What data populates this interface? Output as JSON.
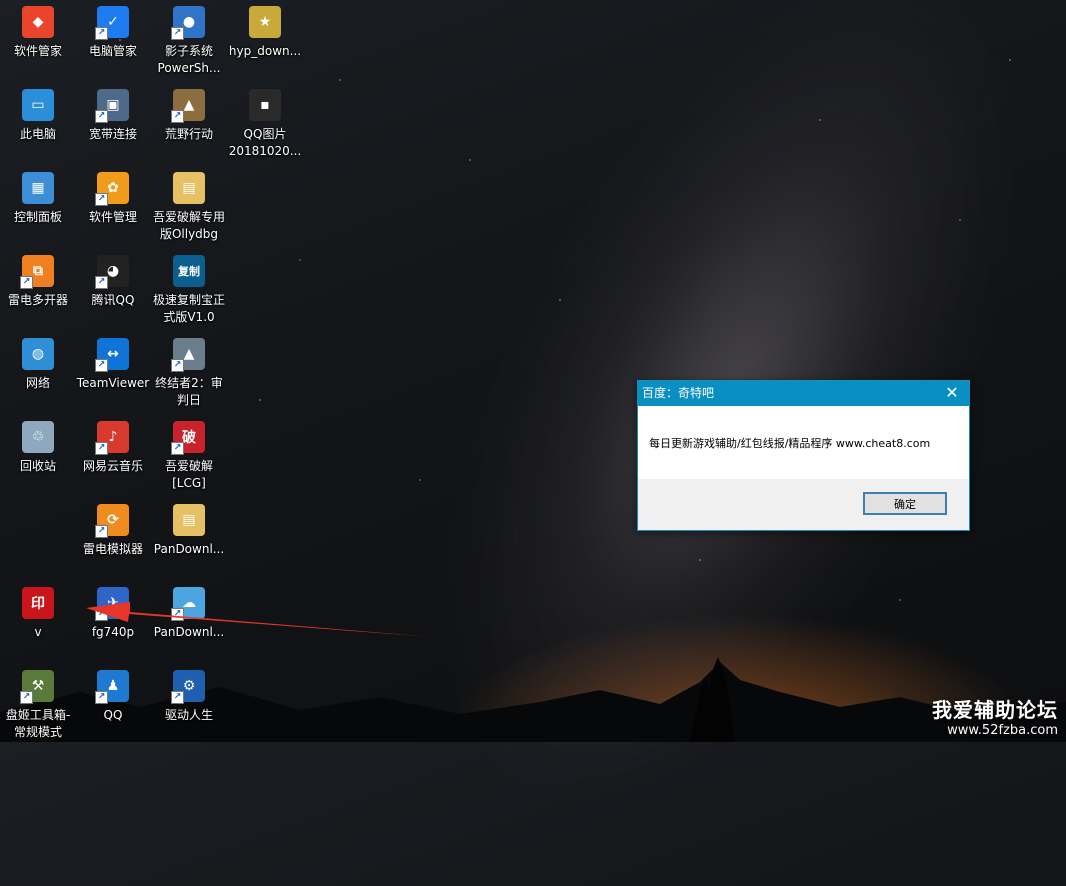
{
  "desktop": {
    "icons": [
      {
        "label": "软件管家",
        "glyph": "◆",
        "color": "#e8452c",
        "shortcut": false
      },
      {
        "label": "电脑管家",
        "glyph": "✓",
        "color": "#1d7cf2",
        "shortcut": true
      },
      {
        "label": "影子系统\nPowerSh...",
        "glyph": "●",
        "color": "#2f74c8",
        "shortcut": true
      },
      {
        "label": "hyp_down...",
        "glyph": "★",
        "color": "#c9a93a",
        "shortcut": false
      },
      {
        "label": "此电脑",
        "glyph": "▭",
        "color": "#2b8ed8",
        "shortcut": false
      },
      {
        "label": "宽带连接",
        "glyph": "▣",
        "color": "#4e6a8a",
        "shortcut": true
      },
      {
        "label": "荒野行动",
        "glyph": "▲",
        "color": "#8b6d3f",
        "shortcut": true
      },
      {
        "label": "QQ图片\n20181020...",
        "glyph": "▪",
        "color": "#2a2a2a",
        "shortcut": false
      },
      {
        "label": "控制面板",
        "glyph": "▦",
        "color": "#3c8fd6",
        "shortcut": false
      },
      {
        "label": "软件管理",
        "glyph": "✿",
        "color": "#f29a1a",
        "shortcut": true
      },
      {
        "label": "吾爱破解专用\n版Ollydbg",
        "glyph": "▤",
        "color": "#e6c063",
        "shortcut": false
      },
      {
        "label": "雷电多开器",
        "glyph": "⧉",
        "color": "#f07f1f",
        "shortcut": true
      },
      {
        "label": "腾讯QQ",
        "glyph": "◕",
        "color": "#222222",
        "shortcut": true
      },
      {
        "label": "极速复制宝正\n式版V1.0",
        "glyph": "复制",
        "color": "#0a5f8e",
        "shortcut": false
      },
      {
        "label": "网络",
        "glyph": "◍",
        "color": "#2f8fd6",
        "shortcut": false
      },
      {
        "label": "TeamViewer",
        "glyph": "↔",
        "color": "#0e74d8",
        "shortcut": true
      },
      {
        "label": "终结者2：审\n判日",
        "glyph": "▲",
        "color": "#6b7e8c",
        "shortcut": true
      },
      {
        "label": "回收站",
        "glyph": "♲",
        "color": "#8da8bf",
        "shortcut": false
      },
      {
        "label": "网易云音乐",
        "glyph": "♪",
        "color": "#d93a2e",
        "shortcut": true
      },
      {
        "label": "吾爱破解\n[LCG]",
        "glyph": "破",
        "color": "#c8232c",
        "shortcut": true
      },
      {
        "label": "雷电模拟器",
        "glyph": "⟳",
        "color": "#f08b1f",
        "shortcut": true
      },
      {
        "label": "PanDownl...",
        "glyph": "▤",
        "color": "#e6c063",
        "shortcut": false
      },
      {
        "label": "v",
        "glyph": "印",
        "color": "#c8141a",
        "shortcut": false
      },
      {
        "label": "fg740p",
        "glyph": "✈",
        "color": "#2f64c8",
        "shortcut": true
      },
      {
        "label": "PanDownl...",
        "glyph": "☁",
        "color": "#4aa5e0",
        "shortcut": true
      },
      {
        "label": "盘姬工具箱-\n常规模式",
        "glyph": "⚒",
        "color": "#5a7a3a",
        "shortcut": true
      },
      {
        "label": "QQ",
        "glyph": "♟",
        "color": "#1e7ad0",
        "shortcut": true
      },
      {
        "label": "驱动人生",
        "glyph": "⚙",
        "color": "#1e5fb0",
        "shortcut": true
      }
    ]
  },
  "dialog": {
    "title": "百度：奇特吧",
    "message": "每日更新游戏辅助/红包线报/精品程序 www.cheat8.com",
    "ok_label": "确定",
    "close_icon": "close-icon"
  },
  "watermark": {
    "title": "我爱辅助论坛",
    "url": "www.52fzba.com"
  },
  "colors": {
    "titlebar": "#0a8fc2",
    "arrow": "#e8352a"
  }
}
